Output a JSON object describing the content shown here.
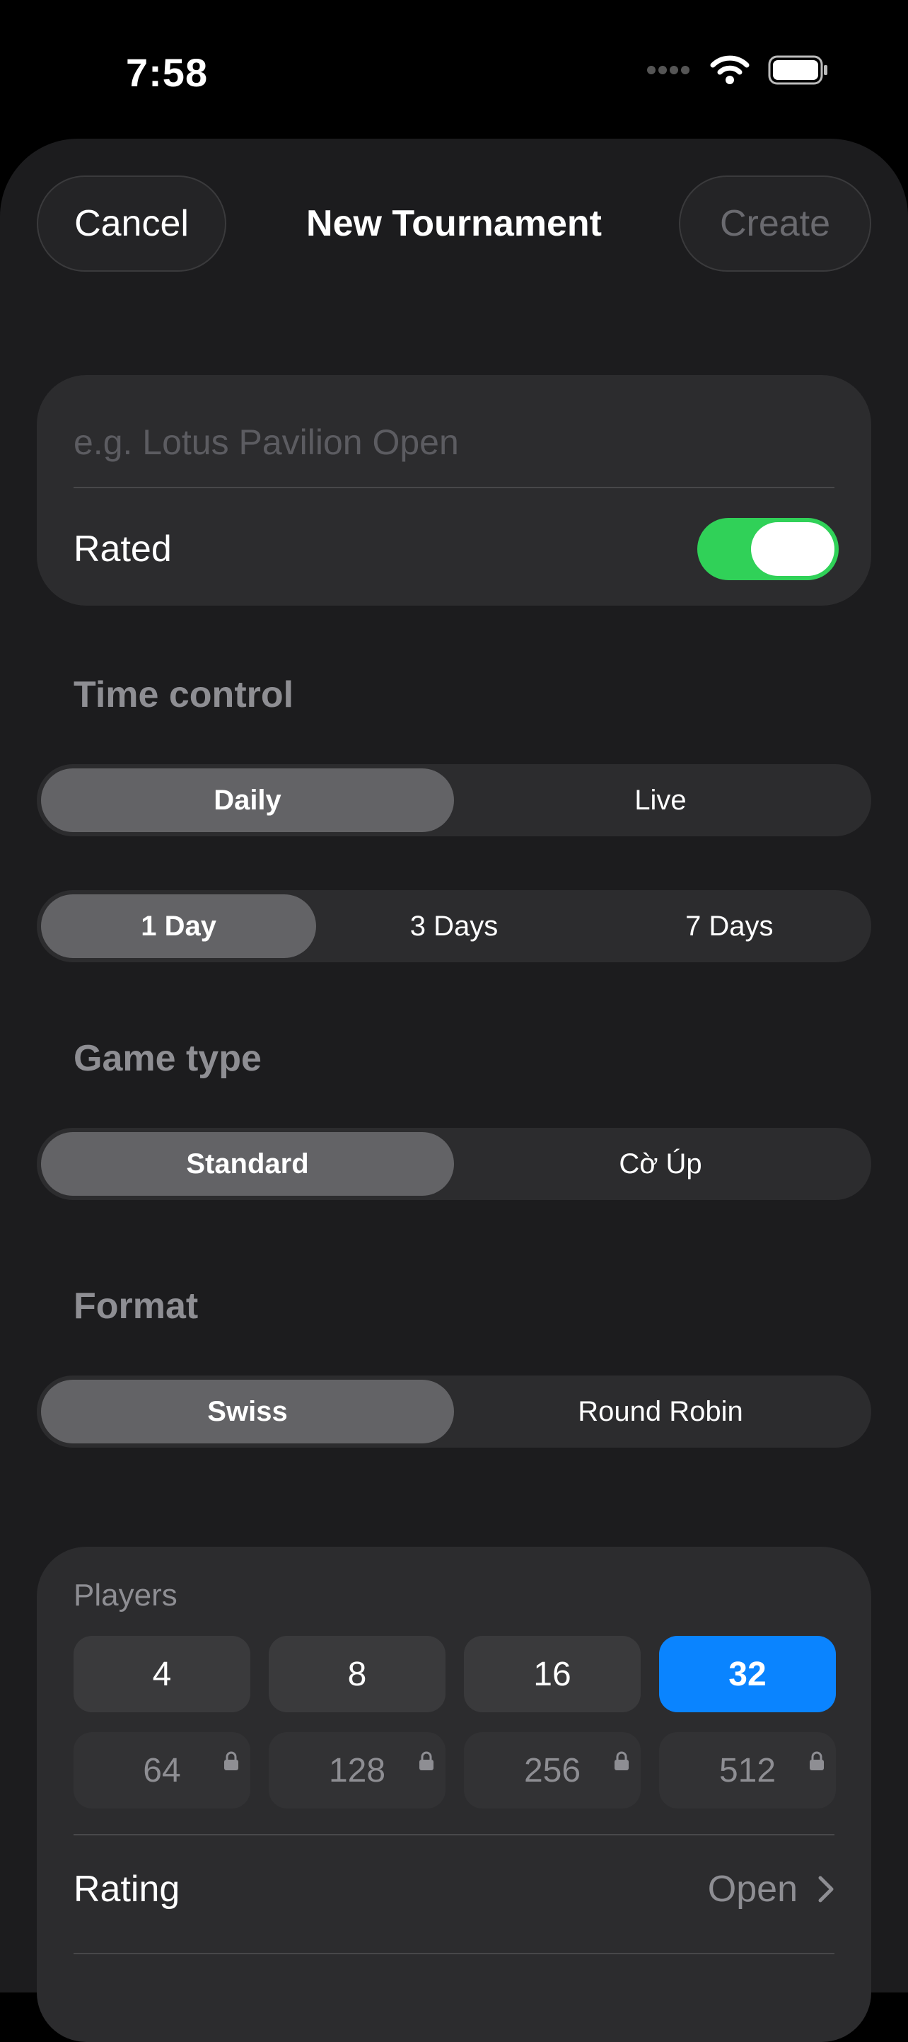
{
  "status_bar": {
    "time": "7:58"
  },
  "nav": {
    "cancel_label": "Cancel",
    "title": "New Tournament",
    "create_label": "Create"
  },
  "name_card": {
    "name_placeholder": "e.g. Lotus Pavilion Open",
    "rated_label": "Rated",
    "rated_on": true
  },
  "time_control": {
    "title": "Time control",
    "modes": [
      {
        "label": "Daily",
        "selected": true
      },
      {
        "label": "Live",
        "selected": false
      }
    ],
    "durations": [
      {
        "label": "1 Day",
        "selected": true
      },
      {
        "label": "3 Days",
        "selected": false
      },
      {
        "label": "7 Days",
        "selected": false
      }
    ]
  },
  "game_type": {
    "title": "Game type",
    "options": [
      {
        "label": "Standard",
        "selected": true
      },
      {
        "label": "Cờ Úp",
        "selected": false
      }
    ]
  },
  "format": {
    "title": "Format",
    "options": [
      {
        "label": "Swiss",
        "selected": true
      },
      {
        "label": "Round Robin",
        "selected": false
      }
    ]
  },
  "players": {
    "label": "Players",
    "options": [
      {
        "label": "4",
        "selected": false,
        "locked": false
      },
      {
        "label": "8",
        "selected": false,
        "locked": false
      },
      {
        "label": "16",
        "selected": false,
        "locked": false
      },
      {
        "label": "32",
        "selected": true,
        "locked": false
      },
      {
        "label": "64",
        "selected": false,
        "locked": true
      },
      {
        "label": "128",
        "selected": false,
        "locked": true
      },
      {
        "label": "256",
        "selected": false,
        "locked": true
      },
      {
        "label": "512",
        "selected": false,
        "locked": true
      }
    ],
    "rating_label": "Rating",
    "rating_value": "Open"
  },
  "colors": {
    "accent": "#0a84ff",
    "toggle_on": "#30d158",
    "background": "#1c1c1e",
    "card": "#2c2c2e",
    "secondary_text": "#8e8e93"
  },
  "icons": [
    "signal-dots-icon",
    "wifi-icon",
    "battery-icon",
    "lock-icon",
    "chevron-right-icon"
  ]
}
